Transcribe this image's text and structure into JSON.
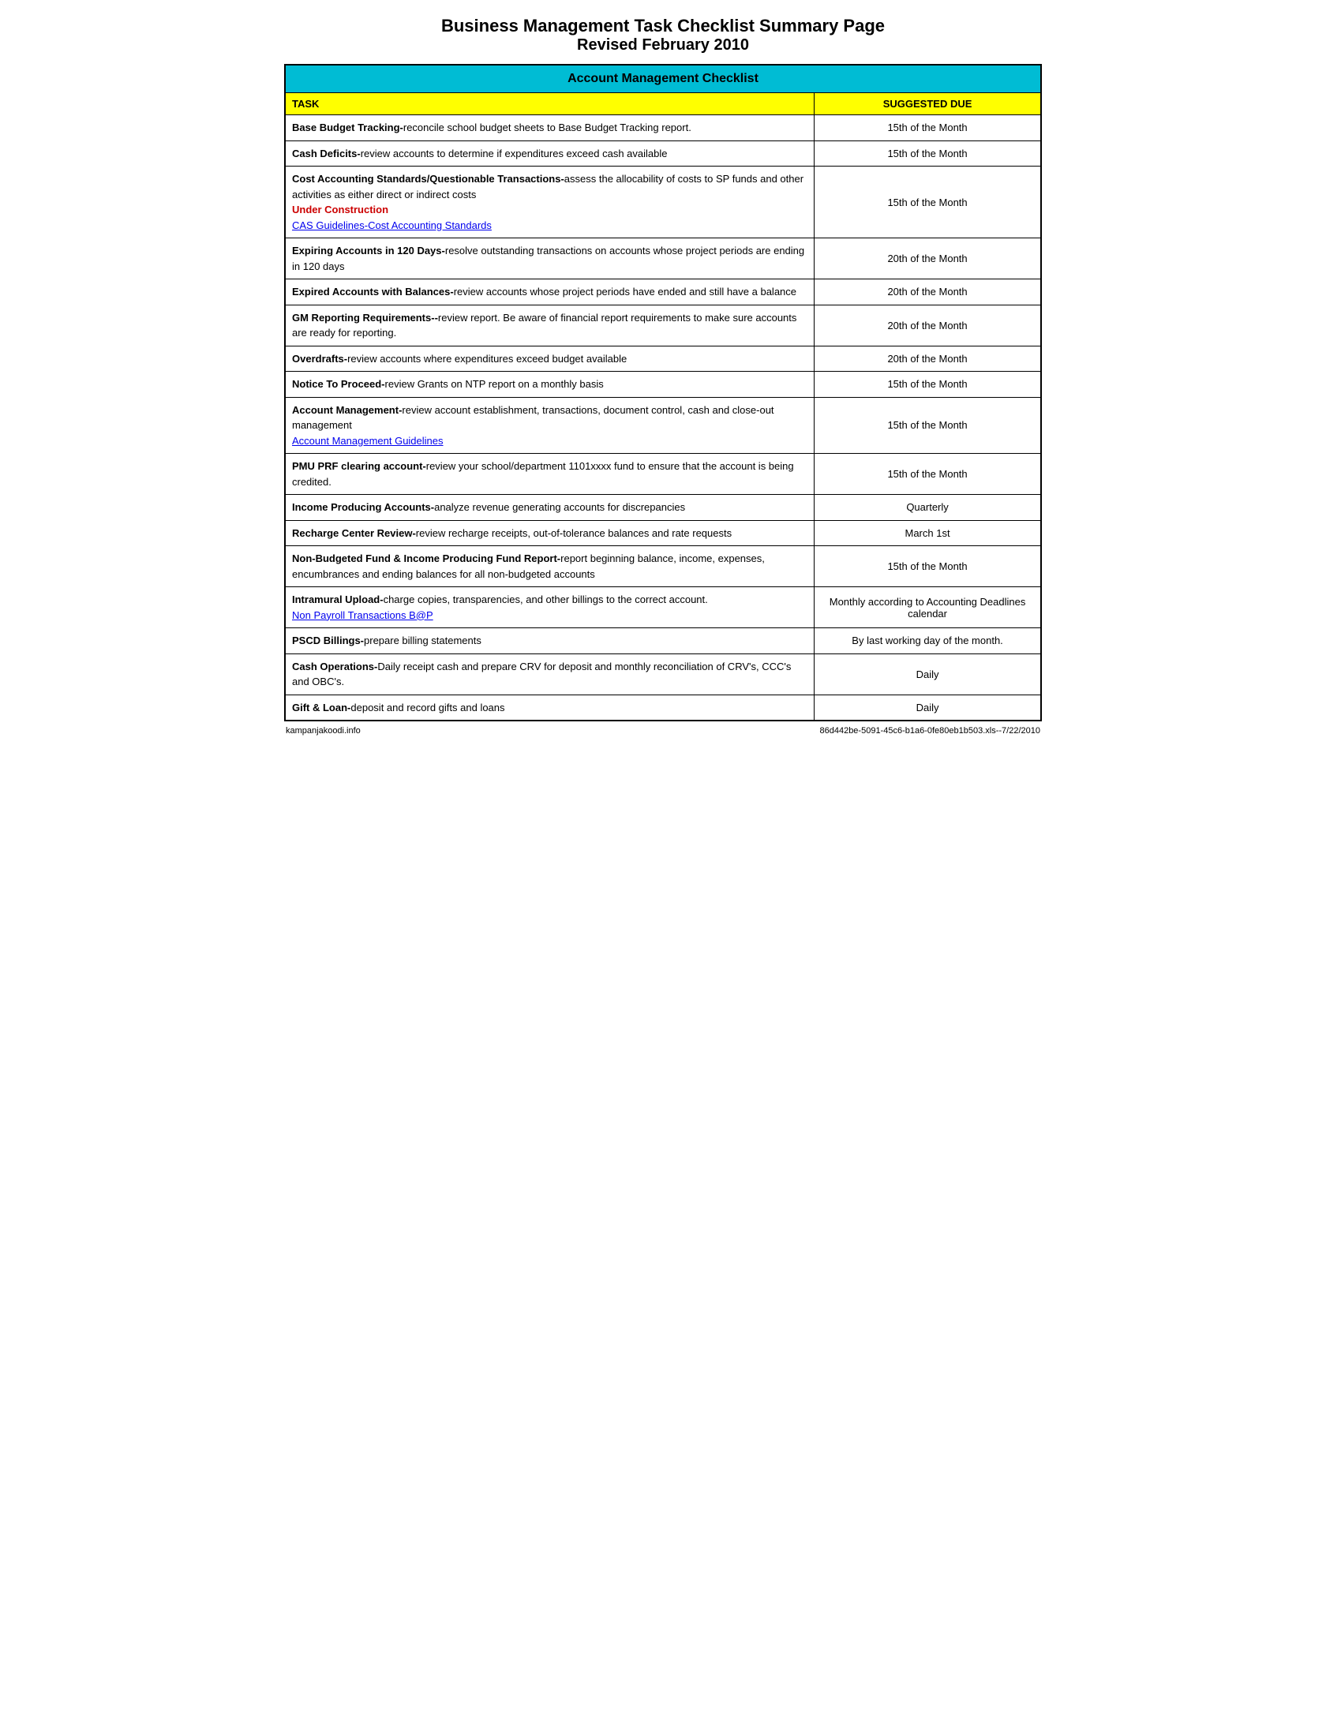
{
  "page": {
    "title_line1": "Business Management Task Checklist Summary Page",
    "title_line2": "Revised February 2010"
  },
  "table": {
    "section_header": "Account Management Checklist",
    "col_task_label": "TASK",
    "col_due_label": "SUGGESTED DUE",
    "rows": [
      {
        "task_bold": "Base Budget Tracking-",
        "task_text": "reconcile school budget sheets to Base Budget Tracking report.",
        "due": "15th of the Month",
        "link": null,
        "under_construction": null
      },
      {
        "task_bold": "Cash Deficits-",
        "task_text": "review accounts to determine if expenditures exceed cash available",
        "due": "15th of the Month",
        "link": null,
        "under_construction": null
      },
      {
        "task_bold": "Cost Accounting Standards/Questionable Transactions-",
        "task_text": "assess the allocability of costs to SP funds and other activities as either direct or indirect costs",
        "due": "15th of the Month",
        "link": "CAS Guidelines-Cost Accounting Standards",
        "under_construction": "Under Construction"
      },
      {
        "task_bold": "Expiring Accounts in 120 Days-",
        "task_text": "resolve outstanding transactions on accounts whose project periods are ending in 120 days",
        "due": "20th of the Month",
        "link": null,
        "under_construction": null
      },
      {
        "task_bold": "Expired Accounts with Balances-",
        "task_text": "review accounts whose project periods have ended and still have a balance",
        "due": "20th of the Month",
        "link": null,
        "under_construction": null
      },
      {
        "task_bold": "GM Reporting Requirements--",
        "task_text": "review report.  Be aware of financial report requirements to make sure accounts are ready for reporting.",
        "due": "20th of the Month",
        "link": null,
        "under_construction": null
      },
      {
        "task_bold": "Overdrafts-",
        "task_text": "review accounts where expenditures exceed budget available",
        "due": "20th of the Month",
        "link": null,
        "under_construction": null
      },
      {
        "task_bold": "Notice To Proceed-",
        "task_text": "review Grants on NTP report on a monthly basis",
        "due": "15th of the Month",
        "link": null,
        "under_construction": null
      },
      {
        "task_bold": "Account Management-",
        "task_text": "review account establishment, transactions, document control, cash and close-out management",
        "due": "15th of the Month",
        "link": "Account Management Guidelines",
        "under_construction": null
      },
      {
        "task_bold": "PMU PRF clearing account-",
        "task_text": "review your school/department 1101xxxx fund to ensure that the account is being credited.",
        "due": "15th of the Month",
        "link": null,
        "under_construction": null
      },
      {
        "task_bold": "Income Producing Accounts-",
        "task_text": "analyze revenue generating accounts for discrepancies",
        "due": "Quarterly",
        "link": null,
        "under_construction": null
      },
      {
        "task_bold": "Recharge Center Review-",
        "task_text": "review recharge receipts, out-of-tolerance balances and rate requests",
        "due": "March 1st",
        "link": null,
        "under_construction": null
      },
      {
        "task_bold": "Non-Budgeted Fund & Income Producing Fund Report-",
        "task_text": "report beginning balance, income, expenses, encumbrances and ending balances for all non-budgeted accounts",
        "due": "15th of the Month",
        "link": null,
        "under_construction": null
      },
      {
        "task_bold": "Intramural Upload-",
        "task_text": "charge copies, transparencies, and other billings to the correct account.",
        "due": "Monthly according to Accounting Deadlines calendar",
        "link": "Non Payroll Transactions B@P",
        "under_construction": null
      },
      {
        "task_bold": "PSCD Billings-",
        "task_text": "prepare billing statements",
        "due": "By last working day of the month.",
        "link": null,
        "under_construction": null
      },
      {
        "task_bold": "Cash Operations-",
        "task_text": "Daily receipt cash and prepare CRV for deposit and monthly reconciliation of CRV's, CCC's  and OBC's.",
        "due": "Daily",
        "link": null,
        "under_construction": null
      },
      {
        "task_bold": "Gift & Loan-",
        "task_text": "deposit and record gifts and loans",
        "due": "Daily",
        "link": null,
        "under_construction": null
      }
    ]
  },
  "footer": {
    "left": "kampanjakoodi.info",
    "right": "86d442be-5091-45c6-b1a6-0fe80eb1b503.xls--7/22/2010"
  }
}
